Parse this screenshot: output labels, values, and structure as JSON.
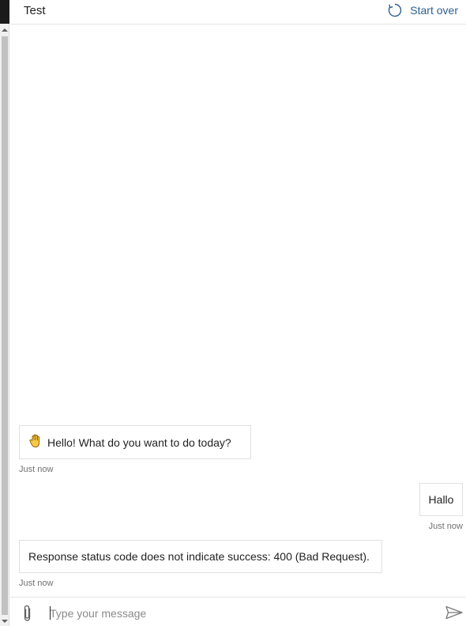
{
  "header": {
    "title": "Test",
    "start_over_label": "Start over",
    "start_over_icon": "refresh-icon"
  },
  "messages": [
    {
      "from": "bot",
      "icon": "wave-hand-icon",
      "text": "Hello! What do you want to do today?",
      "timestamp": "Just now"
    },
    {
      "from": "user",
      "text": "Hallo",
      "timestamp": "Just now"
    },
    {
      "from": "bot",
      "text": "Response status code does not indicate success: 400 (Bad Request).",
      "timestamp": "Just now"
    }
  ],
  "composer": {
    "placeholder": "Type your message",
    "value": "",
    "attach_icon": "paperclip-icon",
    "send_icon": "send-icon"
  },
  "colors": {
    "accent": "#2d5f8f",
    "border": "#e0e0e0",
    "timestamp": "#707070"
  }
}
